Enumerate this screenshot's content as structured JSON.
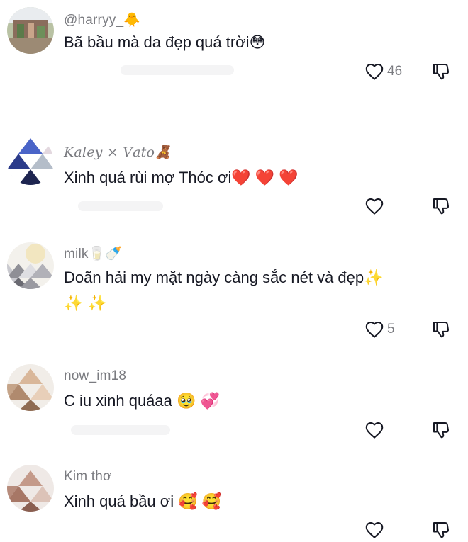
{
  "comments": [
    {
      "username": "@harryy_🐥",
      "text": "Bã bầu mà da đẹp quá trời😳",
      "likes": "46"
    },
    {
      "username": "𝐾𝑎𝑙𝑒𝑦 × 𝑉𝑎𝑡𝑜🧸",
      "text": "Xinh quá rùi mợ Thóc ơi❤️ ❤️ ❤️",
      "likes": ""
    },
    {
      "username": "milk🥛🍼",
      "text": "Doãn hải my mặt ngày càng sắc nét và đẹp✨ ✨ ✨",
      "likes": "5"
    },
    {
      "username": "now_im18",
      "text": "C iu xinh quáaa 🥹 💞",
      "likes": ""
    },
    {
      "username": "Kim thơ",
      "text": "Xinh quá bầu ơi 🥰 🥰",
      "likes": ""
    }
  ],
  "icons": {
    "like": "heart-outline-icon",
    "dislike": "thumbs-down-icon"
  },
  "colors": {
    "text": "#161823",
    "secondary": "#7a7b80",
    "icon": "#161823"
  }
}
